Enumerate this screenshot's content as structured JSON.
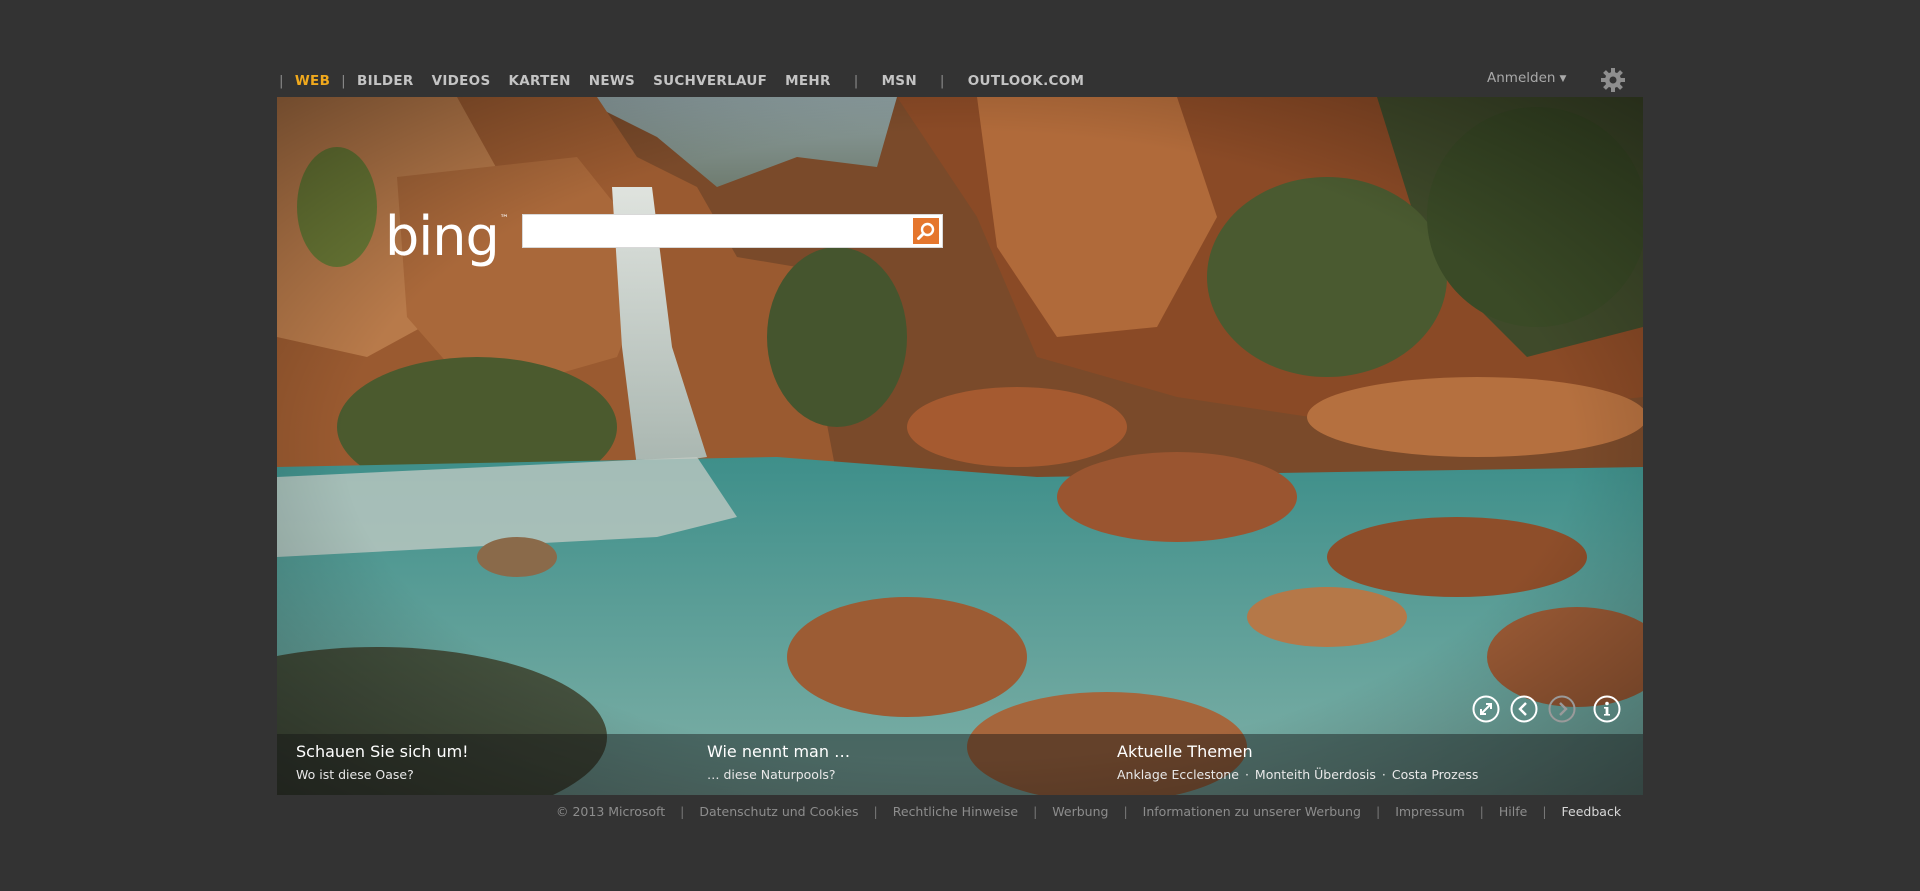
{
  "nav": {
    "items": [
      {
        "label": "WEB",
        "active": true
      },
      {
        "label": "BILDER"
      },
      {
        "label": "VIDEOS"
      },
      {
        "label": "KARTEN"
      },
      {
        "label": "NEWS"
      },
      {
        "label": "SUCHVERLAUF"
      },
      {
        "label": "MEHR"
      }
    ],
    "msn": "MSN",
    "outlook": "OUTLOOK.COM",
    "signin": "Anmelden",
    "separator": "|"
  },
  "logo": {
    "text": "bing",
    "tm": "™"
  },
  "search": {
    "value": "",
    "placeholder": ""
  },
  "hotspots": [
    {
      "title": "Schauen Sie sich um!",
      "sub": "Wo ist diese Oase?"
    },
    {
      "title": "Wie nennt man …",
      "sub": "… diese Naturpools?"
    },
    {
      "title": "Aktuelle Themen",
      "topics": [
        "Anklage Ecclestone",
        "Monteith Überdosis",
        "Costa Prozess"
      ],
      "dot": "·"
    }
  ],
  "controls": [
    "expand-icon",
    "previous-arrow-icon",
    "next-arrow-icon",
    "info-icon"
  ],
  "footer": {
    "copyright": "© 2013 Microsoft",
    "links": [
      "Datenschutz und Cookies",
      "Rechtliche Hinweise",
      "Werbung",
      "Informationen zu unserer Werbung",
      "Impressum",
      "Hilfe",
      "Feedback"
    ]
  },
  "colors": {
    "background": "#333333",
    "accent_active": "#f0a91d",
    "search_button": "#e5762d",
    "nav_text": "#c4c4c4"
  }
}
